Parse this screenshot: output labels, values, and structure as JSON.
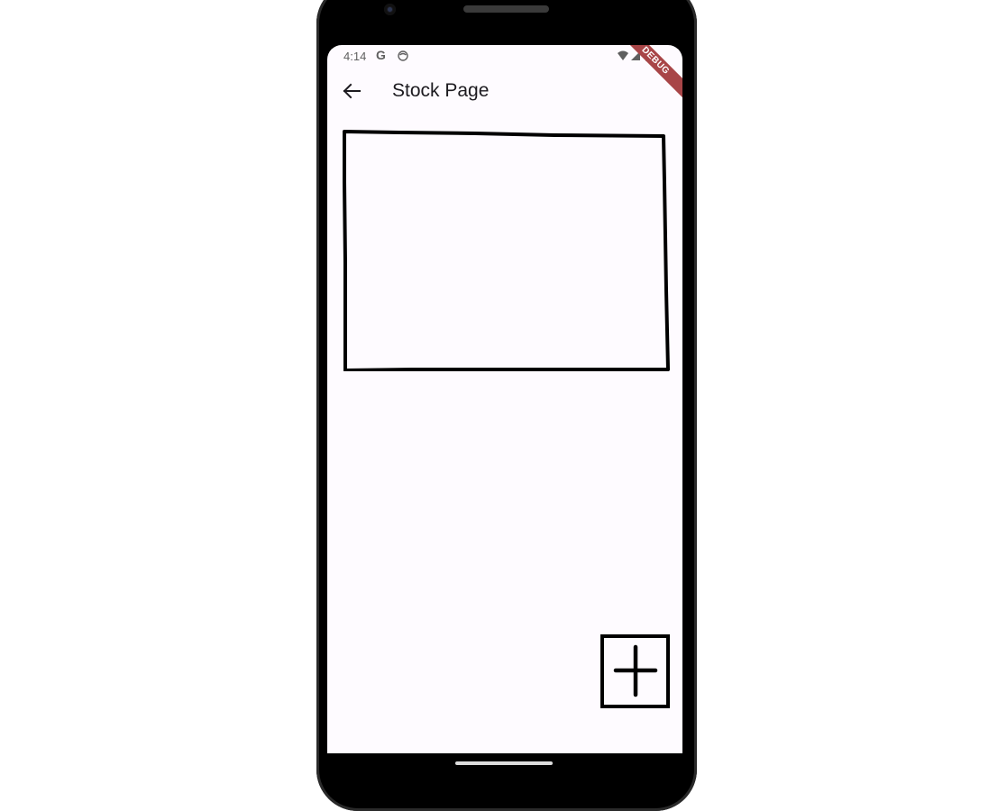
{
  "status_bar": {
    "time": "4:14",
    "g_icon": "G",
    "icons": [
      "google-icon",
      "face-icon",
      "wifi-icon",
      "signal-icon",
      "battery-icon"
    ]
  },
  "debug_banner": "DEBUG",
  "app_bar": {
    "back_icon": "arrow-back-icon",
    "title": "Stock Page"
  },
  "fab": {
    "icon": "plus-icon"
  },
  "colors": {
    "screen_background": "#fefbff",
    "title_text": "#1d1b20",
    "status_text": "#5f5f5f",
    "debug_banner": "#a84547"
  }
}
